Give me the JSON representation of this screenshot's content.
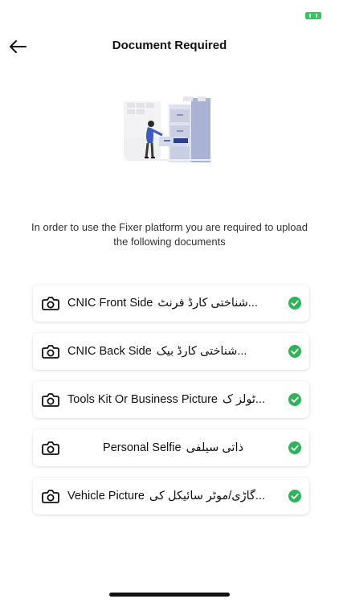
{
  "header": {
    "title": "Document Required"
  },
  "intro": "In order to use the Fixer platform you are required to upload the following documents",
  "documents": [
    {
      "english": "CNIC Front Side",
      "urdu": "...شناختی کارڈ فرنٹ",
      "status": "uploaded"
    },
    {
      "english": "CNIC Back Side",
      "urdu": "...شناختی کارڈ بیک",
      "status": "uploaded"
    },
    {
      "english": "Tools Kit Or Business Picture",
      "urdu": "...ٹولز ک",
      "status": "uploaded"
    },
    {
      "english": "Personal Selfie",
      "urdu": "ذاتی سیلفی",
      "status": "uploaded"
    },
    {
      "english": "Vehicle Picture",
      "urdu": "...گاڑی/موٹر سائیکل کی",
      "status": "uploaded"
    }
  ],
  "icons": {
    "back": "arrow-left-icon",
    "camera": "camera-icon",
    "check": "check-circle-icon",
    "battery": "battery-icon"
  },
  "colors": {
    "check": "#2fb35a",
    "battery": "#34c759"
  }
}
